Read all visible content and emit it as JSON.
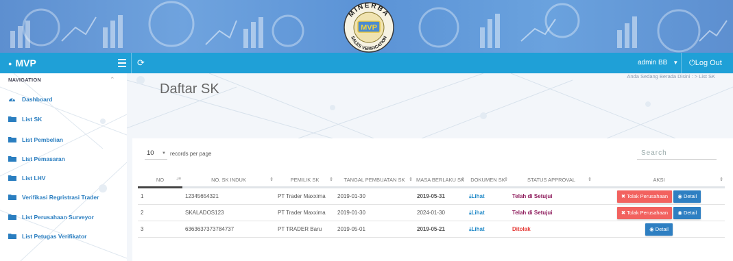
{
  "banner": {
    "logo_arc_text": "MINERBA",
    "logo_center_text": "MVP",
    "logo_bottom_text": "SALES VERIFICATION"
  },
  "topbar": {
    "brand": "MVP",
    "user_label": "admin BB",
    "logout_label": "Log Out",
    "color": "#1fa0d7"
  },
  "sidebar": {
    "heading": "NAVIGATION",
    "items": [
      {
        "label": "Dashboard",
        "icon": "dashboard-icon"
      },
      {
        "label": "List SK",
        "icon": "folder-icon"
      },
      {
        "label": "List Pembelian",
        "icon": "folder-icon"
      },
      {
        "label": "List Pemasaran",
        "icon": "folder-icon"
      },
      {
        "label": "List LHV",
        "icon": "folder-icon"
      },
      {
        "label": "Verifikasi Regristrasi Trader",
        "icon": "folder-icon"
      },
      {
        "label": "List Perusahaan Surveyor",
        "icon": "folder-icon"
      },
      {
        "label": "List Petugas Verifikator",
        "icon": "folder-icon"
      }
    ]
  },
  "main": {
    "title": "Daftar SK",
    "breadcrumb": "Anda Sedang Berada Disini : > List SK"
  },
  "table_controls": {
    "page_length": "10",
    "length_suffix": "records per page",
    "search_placeholder": "Search"
  },
  "table": {
    "columns": [
      "NO",
      "NO. SK INDUK",
      "PEMILIK SK",
      "TANGAL PEMBUATAN SK",
      "MASA BERLAKU SK",
      "DOKUMEN SK",
      "STATUS APPROVAL",
      "AKSI"
    ],
    "rows": [
      {
        "no": "1",
        "sk_induk": "12345654321",
        "pemilik": "PT Trader Maxxima",
        "tgl_pembuatan": "2019-01-30",
        "masa_berlaku": "2019-05-31",
        "masa_expired": true,
        "dokumen": "Lihat",
        "status": "Telah di Setujui",
        "status_type": "ok",
        "tolak_label": "Tolak Perusahaan",
        "detail_label": "Detail"
      },
      {
        "no": "2",
        "sk_induk": "SKALADOS123",
        "pemilik": "PT Trader Maxxima",
        "tgl_pembuatan": "2019-01-30",
        "masa_berlaku": "2024-01-30",
        "masa_expired": false,
        "dokumen": "Lihat",
        "status": "Telah di Setujui",
        "status_type": "ok",
        "tolak_label": "Tolak Perusahaan",
        "detail_label": "Detail"
      },
      {
        "no": "3",
        "sk_induk": "6363637373784737",
        "pemilik": "PT TRADER Baru",
        "tgl_pembuatan": "2019-05-01",
        "masa_berlaku": "2019-05-21",
        "masa_expired": true,
        "dokumen": "Lihat",
        "status": "Ditolak",
        "status_type": "rejected",
        "tolak_label": "",
        "detail_label": "Detail"
      }
    ]
  },
  "colors": {
    "accent": "#1fa0d7",
    "link": "#2a7ec0",
    "danger": "#e53935",
    "approved": "#8e1c5c",
    "btn_red": "#f2625f",
    "btn_blue": "#2e7fc2"
  }
}
